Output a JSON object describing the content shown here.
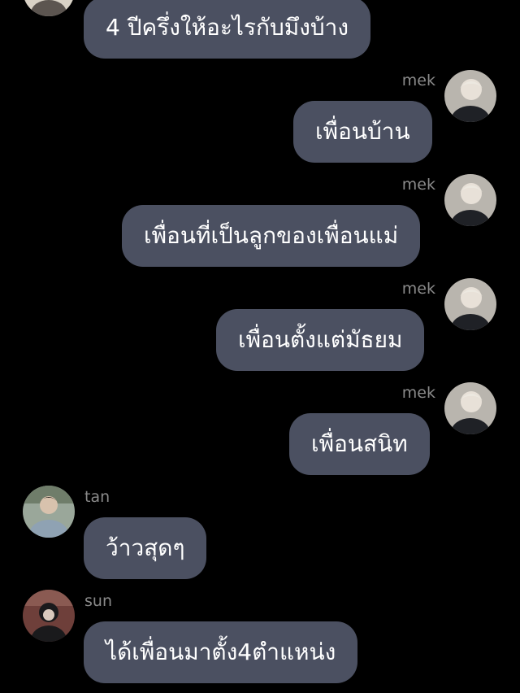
{
  "messages": [
    {
      "sender": "",
      "side": "left",
      "text": "4 ปีครึ่งให้อะไรกับมึงบ้าง"
    },
    {
      "sender": "mek",
      "side": "right",
      "text": "เพื่อนบ้าน"
    },
    {
      "sender": "mek",
      "side": "right",
      "text": "เพื่อนที่เป็นลูกของเพื่อนแม่"
    },
    {
      "sender": "mek",
      "side": "right",
      "text": "เพื่อนตั้งแต่มัธยม"
    },
    {
      "sender": "mek",
      "side": "right",
      "text": "เพื่อนสนิท"
    },
    {
      "sender": "tan",
      "side": "left",
      "text": "ว้าวสุดๆ"
    },
    {
      "sender": "sun",
      "side": "left",
      "text": "ได้เพื่อนมาตั้ง4ตำแหน่ง"
    }
  ],
  "colors": {
    "background": "#000000",
    "bubble": "#4b5061",
    "text": "#ffffff",
    "sender_name": "#8a8a8a"
  },
  "icons": {
    "mek": "avatar-photo",
    "tan": "avatar-photo",
    "sun": "avatar-photo"
  }
}
